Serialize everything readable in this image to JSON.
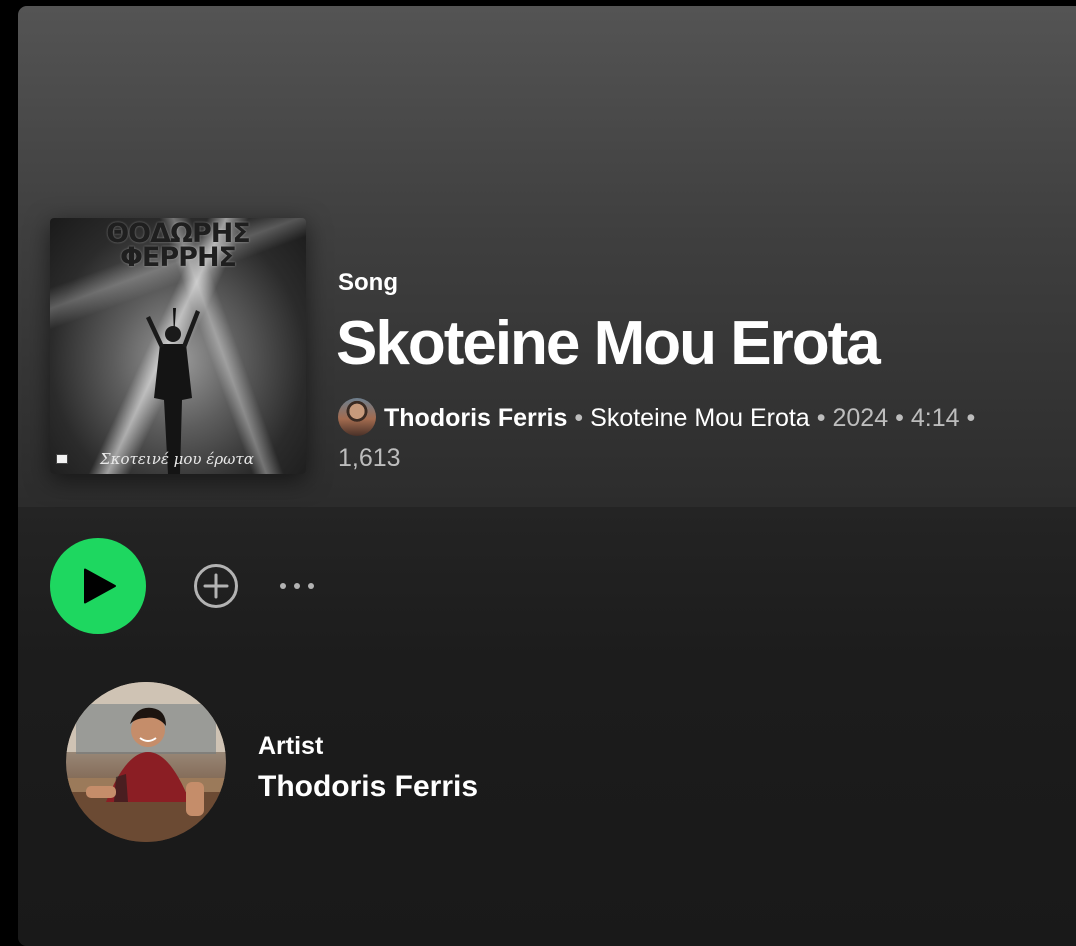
{
  "track": {
    "type_label": "Song",
    "title": "Skoteine Mou Erota",
    "artist": "Thodoris Ferris",
    "album": "Skoteine Mou Erota",
    "year": "2024",
    "duration": "4:14",
    "play_count": "1,613",
    "separator": "•"
  },
  "cover": {
    "title_line1": "ΘΟΔΩΡΗΣ",
    "title_line2": "ΦΕΡΡΗΣ",
    "script_text": "Σκοτεινέ μου έρωτα"
  },
  "actions": {
    "play_icon": "play-icon",
    "add_icon": "add-circle-icon",
    "more_icon": "more-options-icon",
    "accent_color": "#1ed760"
  },
  "artist_section": {
    "label": "Artist",
    "name": "Thodoris Ferris"
  }
}
